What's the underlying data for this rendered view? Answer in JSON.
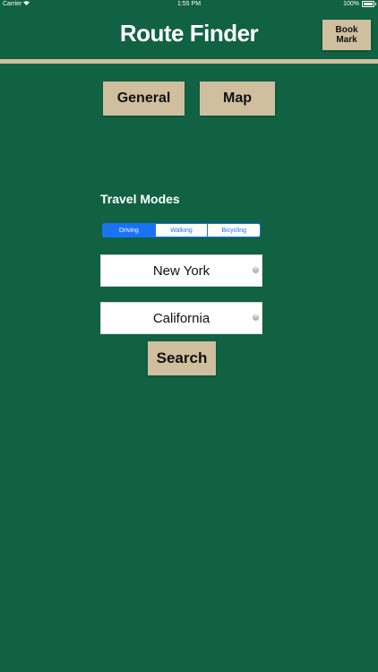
{
  "status_bar": {
    "carrier": "Carrier",
    "time": "1:55 PM",
    "battery": "100%"
  },
  "header": {
    "title": "Route Finder",
    "bookmark_label": "Book Mark"
  },
  "nav": {
    "general_label": "General",
    "map_label": "Map"
  },
  "travel": {
    "section_label": "Travel Modes",
    "modes": [
      "Driving",
      "Walking",
      "Bicycling"
    ],
    "selected": "Driving"
  },
  "inputs": {
    "origin_value": "New York",
    "destination_value": "California"
  },
  "actions": {
    "search_label": "Search"
  },
  "colors": {
    "background": "#106242",
    "accent_tan": "#cfbf9e",
    "segment_blue": "#1a73f5"
  },
  "icons": {
    "clear": "x-circle"
  }
}
